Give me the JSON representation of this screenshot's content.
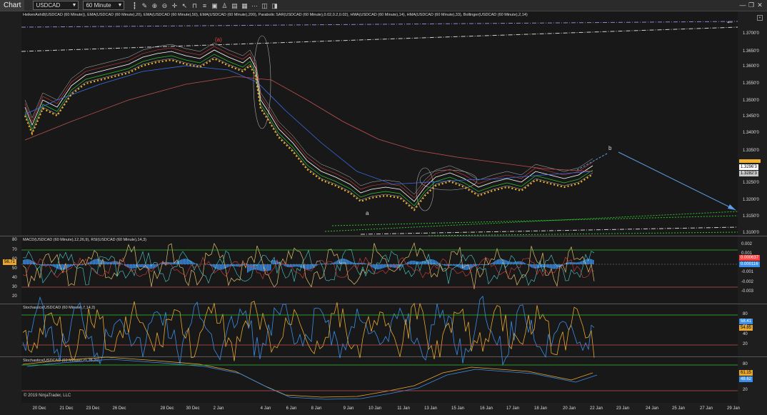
{
  "toolbar": {
    "tab_label": "Chart",
    "instrument": "USDCAD",
    "interval": "60 Minute",
    "icons": [
      "bar-type-icon",
      "draw-tool-icon",
      "zoom-icon",
      "zoom-out-icon",
      "crosshair-icon",
      "pointer-icon",
      "magnet-icon",
      "lines-icon",
      "properties-icon",
      "strategy-icon",
      "template-icon",
      "data-box-icon",
      "more-icon",
      "tool-a-icon",
      "tool-b-icon"
    ]
  },
  "window_buttons": [
    "minimize-icon",
    "restore-icon",
    "close-icon"
  ],
  "price_panel": {
    "legend": "HeikenAshi8(USDCAD (60 Minute)), EMA(USDCAD (60 Minute),20), EMA(USDCAD (60 Minute),50), EMA(USDCAD (60 Minute),200), Parabolic SAR(USDCAD (60 Minute),0.02,0.2,0.02), HMA(USDCAD (60 Minute),14), HMA(USDCAD (60 Minute),33), Bollinger(USDCAD (60 Minute),2,14)",
    "y_ticks": [
      "1.3700'0",
      "1.3650'0",
      "1.3600'0",
      "1.3550'0",
      "1.3500'0",
      "1.3450'0",
      "1.3400'0",
      "1.3350'0",
      "1.3250'0",
      "1.3200'0",
      "1.3150'0",
      "1.3100'0"
    ],
    "price_tags": [
      {
        "text": "1.3296'3",
        "bg": "#ffffff"
      },
      {
        "text": "1.3282'3",
        "bg": "#c8c8c8"
      }
    ],
    "annotations": {
      "wave_a_top": "(a)",
      "wave_a": "a",
      "wave_b": "b"
    }
  },
  "macd_panel": {
    "legend": "MACD(USDCAD (60 Minute),12,26,9), RSI(USDCAD (60 Minute),14,3)",
    "left_ticks": [
      "80",
      "70",
      "60",
      "50",
      "40",
      "30",
      "20"
    ],
    "right_ticks": [
      "0.002",
      "0.001",
      "-0.001",
      "-0.002",
      "-0.003"
    ],
    "rsi_tag": "56.71",
    "macd_tags": [
      {
        "text": "0.000637",
        "bg": "#ff4040"
      },
      {
        "text": "0.000116",
        "bg": "#3a8ee8"
      }
    ]
  },
  "stoch1_panel": {
    "legend": "Stochastics(USDCAD (60 Minute),7,14,3)",
    "right_ticks": [
      "80",
      "60",
      "40",
      "20"
    ],
    "tags": [
      {
        "text": "58.41",
        "bg": "#3a8ee8"
      },
      {
        "text": "54.85",
        "bg": "#e8a830"
      }
    ]
  },
  "stoch2_panel": {
    "legend": "Stochastics(USDCAD (60 Minute),21,35,21)",
    "right_ticks": [
      "80",
      "60",
      "40",
      "20"
    ],
    "tags": [
      {
        "text": "61.15",
        "bg": "#e8a830"
      },
      {
        "text": "48.62",
        "bg": "#3a8ee8"
      }
    ]
  },
  "copyright": "© 2019 NinjaTrader, LLC",
  "x_labels": [
    "20 Dec",
    "21 Dec",
    "23 Dec",
    "26 Dec",
    "28 Dec",
    "30 Dec",
    "2 Jan",
    "4 Jan",
    "6 Jan",
    "8 Jan",
    "9 Jan",
    "10 Jan",
    "11 Jan",
    "13 Jan",
    "15 Jan",
    "16 Jan",
    "17 Jan",
    "18 Jan",
    "20 Jan",
    "22 Jan",
    "23 Jan",
    "24 Jan",
    "25 Jan",
    "27 Jan",
    "29 Jan"
  ],
  "colors": {
    "sar": "#f0b030",
    "ema200": "#c05050",
    "ema50": "#3a6ee8",
    "trend": "#8a8ad0",
    "target": "#5aa0e8",
    "green": "#30c030"
  }
}
